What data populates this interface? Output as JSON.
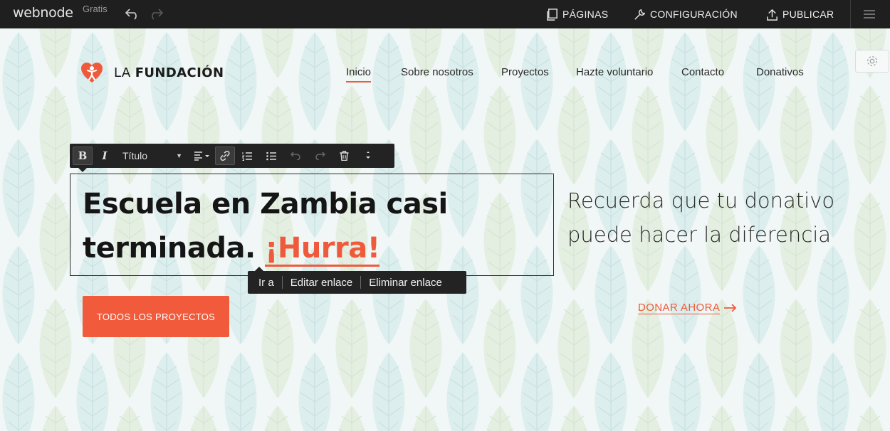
{
  "topbar": {
    "brand": "webnode",
    "plan": "Gratis",
    "pages_label": "PÁGINAS",
    "settings_label": "CONFIGURACIÓN",
    "publish_label": "PUBLICAR"
  },
  "site": {
    "logo_prefix": "LA",
    "logo_bold": "FUNDACIÓN",
    "nav": [
      "Inicio",
      "Sobre nosotros",
      "Proyectos",
      "Hazte voluntario",
      "Contacto",
      "Donativos"
    ],
    "active_nav": "Inicio"
  },
  "toolbar": {
    "bold": "B",
    "italic": "I",
    "style_value": "Título"
  },
  "hero": {
    "title_line1": "Escuela en Zambia casi",
    "title_line2": "terminada.",
    "title_link": "¡Hurra!",
    "cta": "TODOS LOS PROYECTOS",
    "side_text": "Recuerda que tu donativo puede hacer la diferencia",
    "donate": "DONAR AHORA"
  },
  "link_popup": {
    "goto": "Ir a",
    "edit": "Editar enlace",
    "remove": "Eliminar enlace"
  },
  "colors": {
    "accent": "#ef5a3c",
    "topbar": "#1f1f1f",
    "toolbar": "#232323"
  }
}
